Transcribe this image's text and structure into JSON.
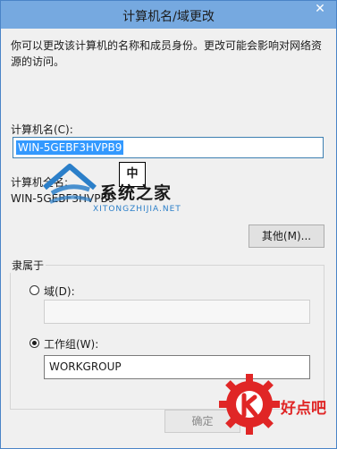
{
  "window": {
    "title": "计算机名/域更改",
    "close_glyph": "✕"
  },
  "description": "你可以更改该计算机的名称和成员身份。更改可能会影响对网络资源的访问。",
  "computer_name": {
    "label": "计算机名(C):",
    "value": "WIN-5GEBF3HVPB9"
  },
  "ime_indicator": "中",
  "full_name": {
    "label": "计算机全名:",
    "value": "WIN-5GEBF3HVPB9"
  },
  "buttons": {
    "other": "其他(M)...",
    "ok": "确定"
  },
  "member_of": {
    "title": "隶属于",
    "domain_label": "域(D):",
    "domain_value": "",
    "workgroup_label": "工作组(W):",
    "workgroup_value": "WORKGROUP",
    "selected": "workgroup"
  },
  "watermarks": {
    "site1_name": "系统之家",
    "site1_url": "XITONGZHIJIA.NET",
    "site2_name": "好点吧"
  },
  "colors": {
    "titlebar": "#76a9e0",
    "selection": "#3399ff",
    "watermark_red": "#e02626",
    "watermark_blue": "#2b7fc9"
  }
}
